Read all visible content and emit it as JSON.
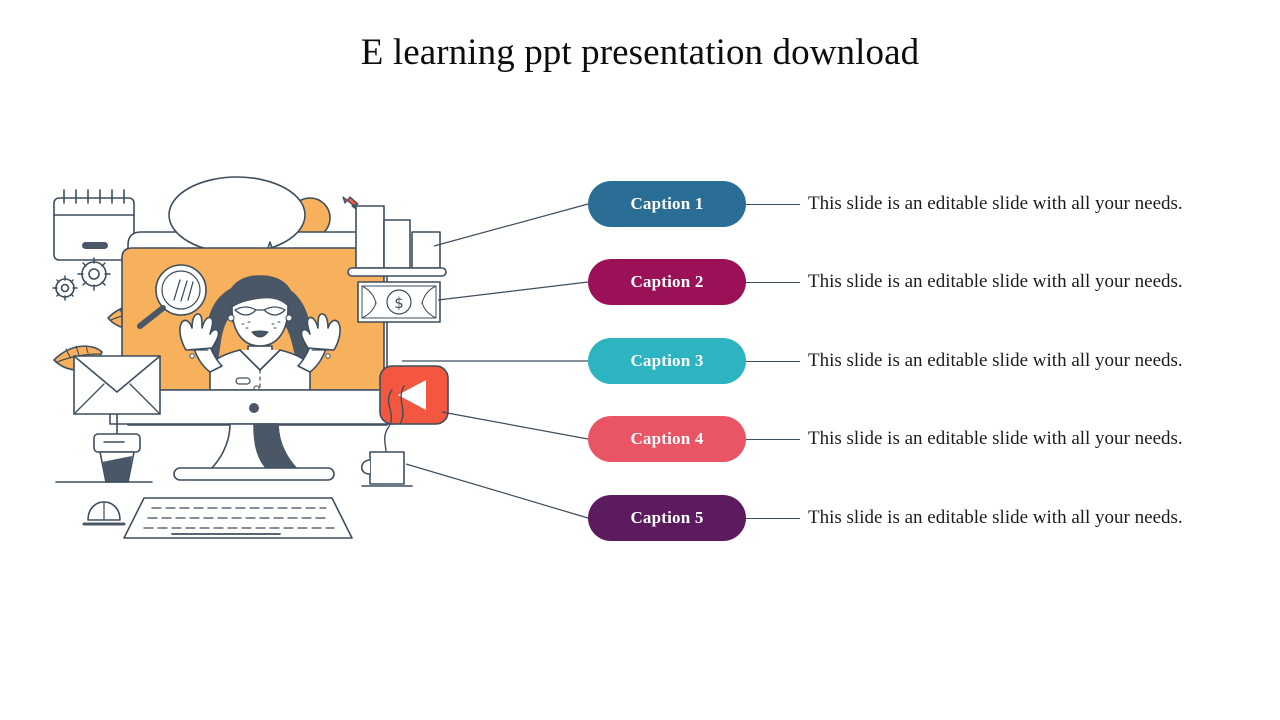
{
  "slide": {
    "title": "E learning ppt presentation download",
    "background_color": "#ffffff",
    "title_color": "#0d0d0d"
  },
  "rows": [
    {
      "caption": "Caption 1",
      "description": "This slide is an editable slide with all your needs.",
      "color": "#2a6e96"
    },
    {
      "caption": "Caption 2",
      "description": "This slide is an editable slide with all your needs.",
      "color": "#9b1158"
    },
    {
      "caption": "Caption 3",
      "description": "This slide is an editable slide with all your needs.",
      "color": "#2cb5c0"
    },
    {
      "caption": "Caption 4",
      "description": "This slide is an editable slide with all your needs.",
      "color": "#ea5565"
    },
    {
      "caption": "Caption 5",
      "description": "This slide is an editable slide with all your needs.",
      "color": "#5c1b5e"
    }
  ],
  "illustration": {
    "name": "e-learning-online-class-illustration",
    "line_color": "#3d4e5e",
    "accent_orange": "#f7b05b",
    "accent_red": "#f4573f",
    "dark_fill": "#4a5766",
    "elements": [
      "desktop-monitor",
      "woman-teacher-waving",
      "speech-bubble",
      "magnifier-icon",
      "notepad-calendar",
      "gears-icon",
      "leaves",
      "envelope-on-stand",
      "keyboard",
      "computer-mouse",
      "orange-circle",
      "arrow-up",
      "books-shelf",
      "banknote",
      "video-play-button",
      "coffee-mug"
    ]
  },
  "connector_color": "#3d4e5e"
}
